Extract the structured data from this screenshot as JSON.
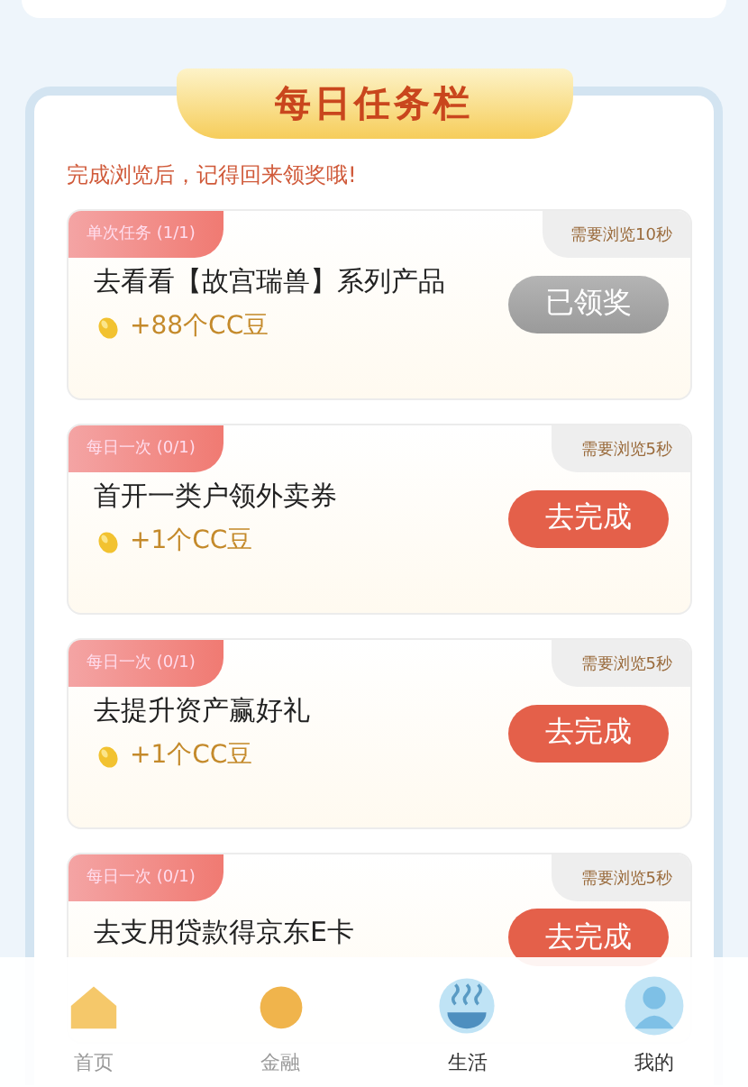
{
  "panel": {
    "title": "每日任务栏",
    "subtitle": "完成浏览后，记得回来领奖哦!"
  },
  "tasks": [
    {
      "tag": "单次任务 (1/1)",
      "requirement": "需要浏览10秒",
      "title": "去看看【故宫瑞兽】系列产品",
      "reward": "+88个CC豆",
      "button": "已领奖",
      "done": true
    },
    {
      "tag": "每日一次 (0/1)",
      "requirement": "需要浏览5秒",
      "title": "首开一类户领外卖券",
      "reward": "+1个CC豆",
      "button": "去完成",
      "done": false
    },
    {
      "tag": "每日一次 (0/1)",
      "requirement": "需要浏览5秒",
      "title": "去提升资产赢好礼",
      "reward": "+1个CC豆",
      "button": "去完成",
      "done": false
    },
    {
      "tag": "每日一次 (0/1)",
      "requirement": "需要浏览5秒",
      "title": "去支用贷款得京东E卡",
      "button": "去完成",
      "done": false
    }
  ],
  "tab_bar": [
    {
      "label": "首页",
      "kind": "home"
    },
    {
      "label": "金融",
      "kind": "finance"
    },
    {
      "label": "生活",
      "kind": "life"
    },
    {
      "label": "我的",
      "kind": "me"
    }
  ]
}
